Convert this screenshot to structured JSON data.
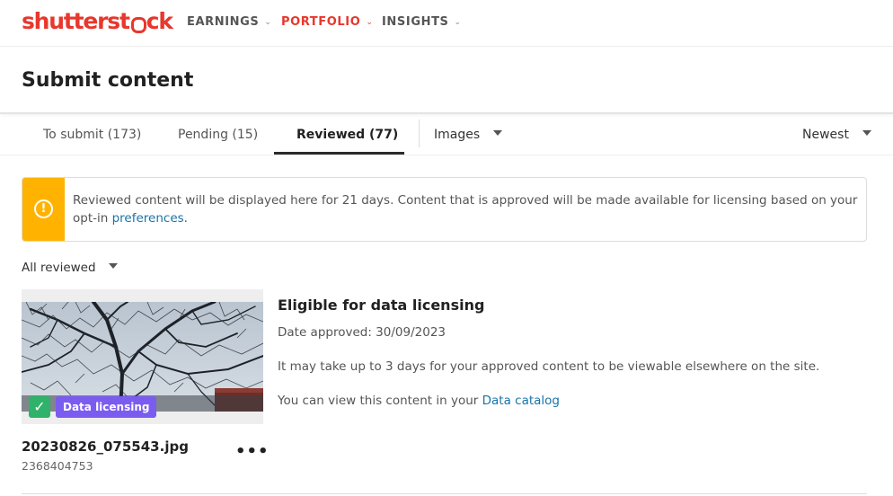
{
  "logo": {
    "before": "shutterst",
    "after": "ck"
  },
  "nav": {
    "earnings": "EARNINGS",
    "portfolio": "PORTFOLIO",
    "insights": "INSIGHTS",
    "chevron": "⌄"
  },
  "page_title": "Submit content",
  "tabs": {
    "to_submit": "To submit (173)",
    "pending": "Pending (15)",
    "reviewed": "Reviewed (77)"
  },
  "media_filter": {
    "selected": "Images"
  },
  "sort": {
    "selected": "Newest"
  },
  "alert": {
    "icon": "!",
    "text": "Reviewed content will be displayed here for 21 days. Content that is approved will be made available for licensing based on your opt-in ",
    "link": "preferences",
    "end": "."
  },
  "review_filter": {
    "selected": "All reviewed"
  },
  "item": {
    "badge_check": "✓",
    "badge_label": "Data licensing",
    "filename": "20230826_075543.jpg",
    "id": "2368404753",
    "more": "•••",
    "status_title": "Eligible for data licensing",
    "date_approved": "Date approved: 30/09/2023",
    "note": "It may take up to 3 days for your approved content to be viewable elsewhere on the site.",
    "catalog_prefix": "You can view this content in your ",
    "catalog_link": "Data catalog"
  },
  "colors": {
    "brand": "#e8372c",
    "alert": "#ffb300",
    "link": "#1a73a8",
    "check_badge": "#2fb26a",
    "dl_badge": "#7b5cf0"
  }
}
